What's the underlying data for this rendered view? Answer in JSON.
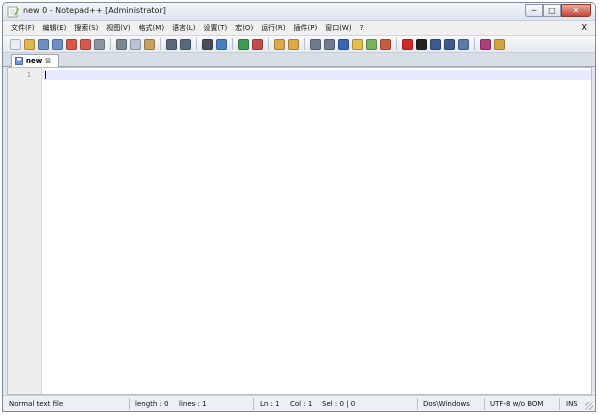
{
  "window": {
    "title": "new  0 - Notepad++ [Administrator]",
    "minimize_glyph": "─",
    "maximize_glyph": "□",
    "close_glyph": "✕"
  },
  "menu": {
    "items": [
      "文件(F)",
      "编辑(E)",
      "搜索(S)",
      "视图(V)",
      "格式(M)",
      "语言(L)",
      "设置(T)",
      "宏(O)",
      "运行(R)",
      "插件(P)",
      "窗口(W)",
      "?"
    ],
    "close_label": "X"
  },
  "toolbar": {
    "icons": [
      {
        "name": "new-file-icon",
        "color": "#e9eef5"
      },
      {
        "name": "open-file-icon",
        "color": "#e3b64a"
      },
      {
        "name": "save-icon",
        "color": "#6c8fc6"
      },
      {
        "name": "save-all-icon",
        "color": "#6c8fc6"
      },
      {
        "name": "close-icon",
        "color": "#d9574a"
      },
      {
        "name": "close-all-icon",
        "color": "#d9574a"
      },
      {
        "name": "print-icon",
        "color": "#8c96a3"
      },
      {
        "sep": true
      },
      {
        "name": "cut-icon",
        "color": "#7d8794"
      },
      {
        "name": "copy-icon",
        "color": "#b8c4d4"
      },
      {
        "name": "paste-icon",
        "color": "#c9a15e"
      },
      {
        "sep": true
      },
      {
        "name": "undo-icon",
        "color": "#5a6a7e"
      },
      {
        "name": "redo-icon",
        "color": "#5a6a7e"
      },
      {
        "sep": true
      },
      {
        "name": "find-icon",
        "color": "#4a4f57"
      },
      {
        "name": "replace-icon",
        "color": "#4a7fbf"
      },
      {
        "sep": true
      },
      {
        "name": "zoom-in-icon",
        "color": "#3f9a55"
      },
      {
        "name": "zoom-out-icon",
        "color": "#c44b4b"
      },
      {
        "sep": true
      },
      {
        "name": "sync-vertical-icon",
        "color": "#e0a84a"
      },
      {
        "name": "sync-horizontal-icon",
        "color": "#e0a84a"
      },
      {
        "sep": true
      },
      {
        "name": "word-wrap-icon",
        "color": "#6d7c90"
      },
      {
        "name": "show-all-chars-icon",
        "color": "#6d7c90"
      },
      {
        "name": "indent-guide-icon",
        "color": "#3b63b5"
      },
      {
        "name": "user-lang-icon",
        "color": "#e1c04d"
      },
      {
        "name": "doc-map-icon",
        "color": "#7cb35a"
      },
      {
        "name": "function-list-icon",
        "color": "#cc5a3d"
      },
      {
        "sep": true
      },
      {
        "name": "record-macro-icon",
        "color": "#d02b2b"
      },
      {
        "name": "stop-record-icon",
        "color": "#222222"
      },
      {
        "name": "play-macro-icon",
        "color": "#3e5a8c"
      },
      {
        "name": "play-multiple-icon",
        "color": "#3e5a8c"
      },
      {
        "name": "save-macro-icon",
        "color": "#5c7aa8"
      },
      {
        "sep": true
      },
      {
        "name": "spell-check-icon",
        "color": "#b03c7a"
      },
      {
        "name": "plugin-icon",
        "color": "#d4a23e"
      }
    ]
  },
  "tab": {
    "label": "new",
    "close_glyph": "⊠"
  },
  "editor": {
    "line_number": "1"
  },
  "statusbar": {
    "file_type": "Normal text file",
    "length": "length : 0",
    "lines": "lines : 1",
    "ln": "Ln : 1",
    "col": "Col : 1",
    "sel": "Sel : 0 | 0",
    "eol": "Dos\\Windows",
    "encoding": "UTF-8 w/o BOM",
    "mode": "INS"
  }
}
